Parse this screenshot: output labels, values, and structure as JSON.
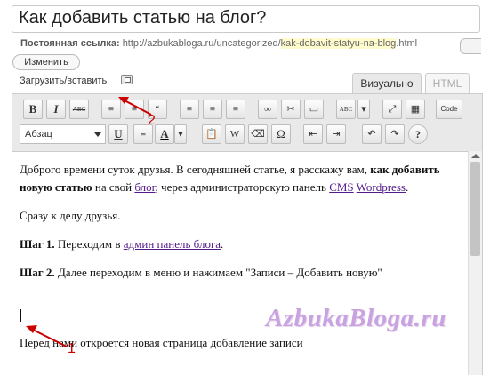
{
  "post": {
    "title": "Как добавить статью на блог?",
    "permalink_label": "Постоянная ссылка:",
    "permalink_base": "http://azbukabloga.ru/uncategorized/",
    "permalink_slug": "kak-dobavit-statyu-na-blog",
    "permalink_ext": ".html",
    "change_button": "Изменить"
  },
  "media": {
    "upload_label": "Загрузить/вставить",
    "upload_icon": "media-icon"
  },
  "tabs": {
    "visual": "Визуально",
    "html": "HTML"
  },
  "toolbar": {
    "row1": [
      {
        "name": "bold-icon",
        "glyph": "B"
      },
      {
        "name": "italic-icon",
        "glyph": "I"
      },
      {
        "name": "strikethrough-icon",
        "glyph": "ABC"
      },
      {
        "name": "bullet-list-icon",
        "glyph": "≡"
      },
      {
        "name": "numbered-list-icon",
        "glyph": "≡"
      },
      {
        "name": "blockquote-icon",
        "glyph": "“"
      },
      {
        "name": "align-left-icon",
        "glyph": "≡"
      },
      {
        "name": "align-center-icon",
        "glyph": "≡"
      },
      {
        "name": "align-right-icon",
        "glyph": "≡"
      },
      {
        "name": "link-icon",
        "glyph": "∞"
      },
      {
        "name": "unlink-icon",
        "glyph": "✂"
      },
      {
        "name": "more-tag-icon",
        "glyph": "▭"
      },
      {
        "name": "spellcheck-icon",
        "glyph": "ABC"
      },
      {
        "name": "spellcheck-dropdown-icon",
        "glyph": "▾"
      },
      {
        "name": "fullscreen-icon",
        "glyph": "⤢"
      },
      {
        "name": "kitchen-sink-icon",
        "glyph": "▦"
      },
      {
        "name": "code-icon",
        "glyph": "Code"
      }
    ],
    "row2": [
      {
        "name": "underline-icon",
        "glyph": "U"
      },
      {
        "name": "justify-icon",
        "glyph": "≡"
      },
      {
        "name": "text-color-icon",
        "glyph": "A"
      },
      {
        "name": "text-color-dropdown-icon",
        "glyph": "▾"
      },
      {
        "name": "paste-text-icon",
        "glyph": "📋"
      },
      {
        "name": "paste-word-icon",
        "glyph": "W"
      },
      {
        "name": "remove-format-icon",
        "glyph": "⌫"
      },
      {
        "name": "special-char-icon",
        "glyph": "Ω"
      },
      {
        "name": "outdent-icon",
        "glyph": "⇤"
      },
      {
        "name": "indent-icon",
        "glyph": "⇥"
      },
      {
        "name": "undo-icon",
        "glyph": "↶"
      },
      {
        "name": "redo-icon",
        "glyph": "↷"
      },
      {
        "name": "help-icon",
        "glyph": "?"
      }
    ],
    "format_select": "Абзац"
  },
  "content": {
    "p1_a": "Доброго времени суток друзья. В сегодняшней статье, я расскажу вам, ",
    "p1_b": "как добавить новую статью",
    "p1_c": " на свой ",
    "p1_link1": "блог",
    "p1_d": ", через администраторскую панель ",
    "p1_link2": "CMS",
    "p1_e": " ",
    "p1_link3": "Wordpress",
    "p1_f": ".",
    "p2": "Сразу к делу друзья.",
    "p3_bold": "Шаг 1.",
    "p3_text": " Переходим в ",
    "p3_link": "админ панель блога",
    "p3_end": ".",
    "p4_bold": "Шаг 2.",
    "p4_text": " Далее переходим в меню и нажимаем \"Записи – Добавить новую\"",
    "p5": "Перед нами откроется новая страница добавление записи"
  },
  "watermark": "AzbukaBloga.ru",
  "annotations": {
    "marker1": "1",
    "marker2": "2"
  },
  "colors": {
    "arrow": "#cc0000",
    "watermark": "#c9a3e0",
    "slug_highlight": "#fffbcc"
  }
}
